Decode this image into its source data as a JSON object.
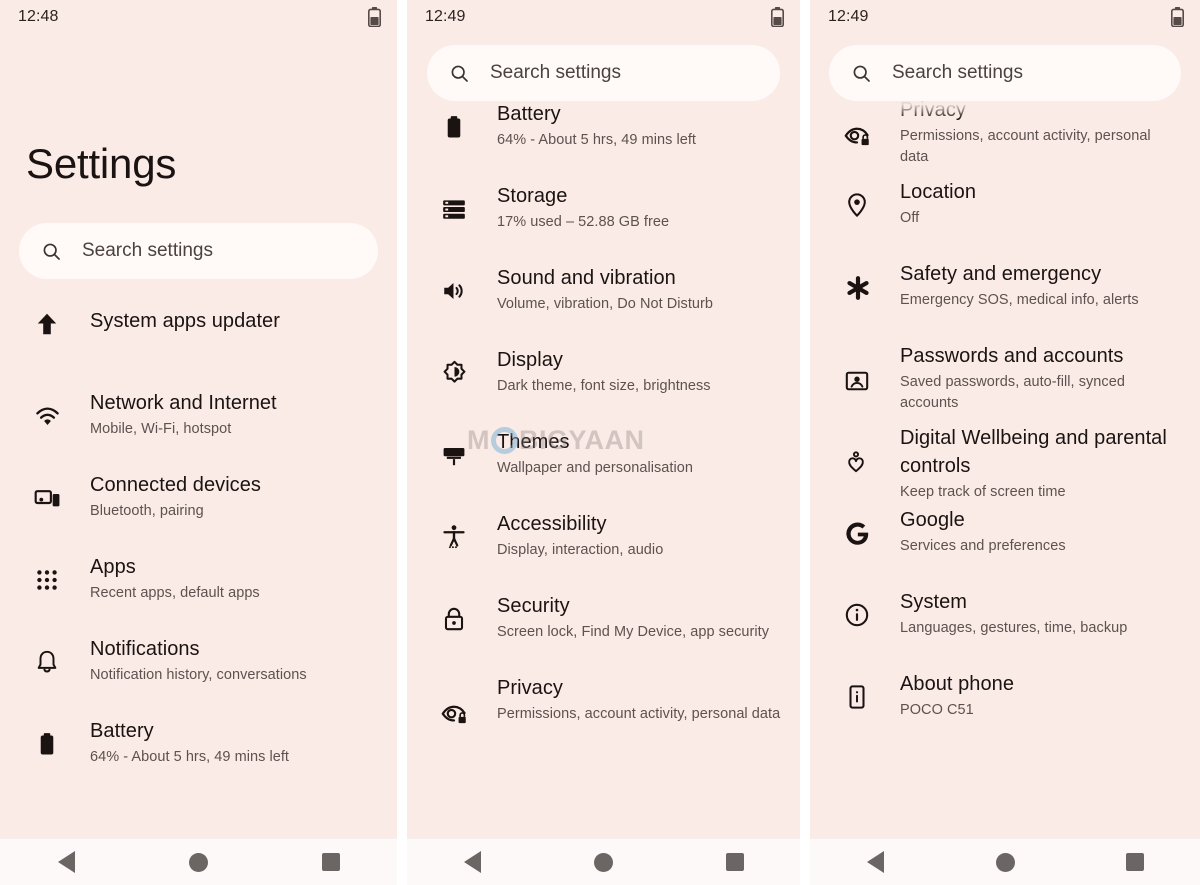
{
  "theme": {
    "background": "#faebe6",
    "search_bg": "#fffaf8",
    "title_color": "#1a1312",
    "sub_color": "#5d524f",
    "nav_bg": "#fcfaf9"
  },
  "watermark": {
    "part1": "M",
    "part2": "BIGYAAN",
    "circle_color": "#6eaad2"
  },
  "search": {
    "placeholder": "Search settings",
    "icon": "search-icon"
  },
  "navbar": {
    "back": "back-icon",
    "home": "home-icon",
    "recents": "recents-icon"
  },
  "panels": [
    {
      "id": "panel-settings-top",
      "status": {
        "time": "12:48",
        "battery_icon": "battery-icon"
      },
      "page_title": "Settings",
      "items": [
        {
          "icon": "arrow-up-icon",
          "title": "System apps updater",
          "sub": ""
        },
        {
          "icon": "wifi-icon",
          "title": "Network and Internet",
          "sub": "Mobile, Wi-Fi, hotspot"
        },
        {
          "icon": "connected-devices-icon",
          "title": "Connected devices",
          "sub": "Bluetooth, pairing"
        },
        {
          "icon": "apps-grid-icon",
          "title": "Apps",
          "sub": "Recent apps, default apps"
        },
        {
          "icon": "bell-icon",
          "title": "Notifications",
          "sub": "Notification history, conversations"
        },
        {
          "icon": "battery-icon",
          "title": "Battery",
          "sub": "64% - About 5 hrs, 49 mins left"
        }
      ]
    },
    {
      "id": "panel-settings-middle",
      "status": {
        "time": "12:49",
        "battery_icon": "battery-icon"
      },
      "page_title": "",
      "items": [
        {
          "icon": "battery-icon",
          "title": "Battery",
          "sub": "64% - About 5 hrs, 49 mins left"
        },
        {
          "icon": "storage-icon",
          "title": "Storage",
          "sub": "17% used – 52.88 GB free"
        },
        {
          "icon": "volume-icon",
          "title": "Sound and vibration",
          "sub": "Volume, vibration, Do Not Disturb"
        },
        {
          "icon": "brightness-icon",
          "title": "Display",
          "sub": "Dark theme, font size, brightness"
        },
        {
          "icon": "paint-roller-icon",
          "title": "Themes",
          "sub": "Wallpaper and personalisation"
        },
        {
          "icon": "accessibility-icon",
          "title": "Accessibility",
          "sub": "Display, interaction, audio"
        },
        {
          "icon": "lock-icon",
          "title": "Security",
          "sub": "Screen lock, Find My Device, app security"
        },
        {
          "icon": "eye-lock-icon",
          "title": "Privacy",
          "sub": "Permissions, account activity, personal data"
        }
      ]
    },
    {
      "id": "panel-settings-bottom",
      "status": {
        "time": "12:49",
        "battery_icon": "battery-icon"
      },
      "page_title": "",
      "items": [
        {
          "icon": "eye-lock-icon",
          "title": "Privacy",
          "sub": "Permissions, account activity, personal data"
        },
        {
          "icon": "location-pin-icon",
          "title": "Location",
          "sub": "Off"
        },
        {
          "icon": "asterisk-icon",
          "title": "Safety and emergency",
          "sub": "Emergency SOS, medical info, alerts"
        },
        {
          "icon": "account-card-icon",
          "title": "Passwords and accounts",
          "sub": "Saved passwords, auto-fill, synced accounts"
        },
        {
          "icon": "wellbeing-icon",
          "title": "Digital Wellbeing and parental controls",
          "sub": "Keep track of screen time"
        },
        {
          "icon": "google-g-icon",
          "title": "Google",
          "sub": "Services and preferences"
        },
        {
          "icon": "info-circle-icon",
          "title": "System",
          "sub": "Languages, gestures, time, backup"
        },
        {
          "icon": "phone-info-icon",
          "title": "About phone",
          "sub": "POCO C51"
        }
      ]
    }
  ]
}
